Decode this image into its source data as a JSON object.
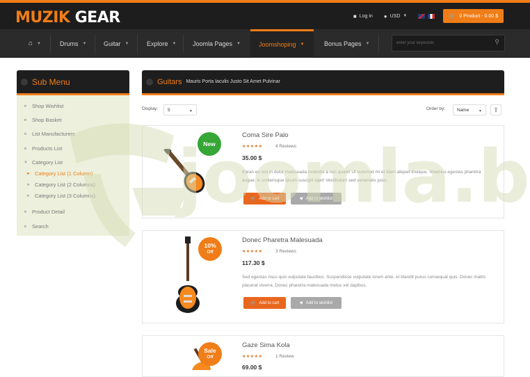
{
  "brand": {
    "part1": "MUZIK",
    "part2": "GEAR",
    "accent": "#f07d17"
  },
  "topbar": {
    "login": "Log in",
    "currency": "USD",
    "cart": "0 Product - 0.00 $"
  },
  "nav": {
    "items": [
      {
        "label": "Drums"
      },
      {
        "label": "Guitar"
      },
      {
        "label": "Explore"
      },
      {
        "label": "Joomla Pages"
      },
      {
        "label": "Joomshoping"
      },
      {
        "label": "Bonus Pages"
      }
    ],
    "search_placeholder": "enter your keywords"
  },
  "sidebar": {
    "title": "Sub Menu",
    "items": [
      {
        "label": "Shop Wishlist"
      },
      {
        "label": "Shop Basket"
      },
      {
        "label": "List Manufacturers"
      },
      {
        "label": "Products List"
      },
      {
        "label": "Category List"
      },
      {
        "label": "Category List (1 Column)"
      },
      {
        "label": "Category List (2 Columns)"
      },
      {
        "label": "Category List (3 Columns)"
      },
      {
        "label": "Product Detail"
      },
      {
        "label": "Search"
      }
    ]
  },
  "main": {
    "title": "Guitars",
    "subtitle": "Mauris Porta Iaculis Justo Sit Amet Pulvinar",
    "display_label": "Display:",
    "display_value": "5",
    "order_label": "Order by:",
    "order_value": "Name"
  },
  "products": [
    {
      "name": "Coma Sire Palo",
      "reviews": "4 Reviews",
      "price": "35.00 $",
      "desc": "Karan eu nisi in dolor malesuada molestie a nec quam! Ut euismod mi et diam aliquet tristique. Vivamus egestas pharetra augue, in scelerisque ipsum suscipit eget! Vestibulum sed venenatis justo.",
      "badge": "New",
      "cart": "Add to cart",
      "wish": "Add to wishlist"
    },
    {
      "name": "Donec Pharetra Malesuada",
      "reviews": "3 Reviews",
      "price": "117.30 $",
      "desc": "Sed egestas risus quis vulputate faucibus. Suspendisse vulputate lorem ante, et blandit purus consequat quis. Donec mattis placerat viverra. Donec pharetra malesuada metus vel dapibus.",
      "badge": "10%",
      "badge_sub": "Off",
      "cart": "Add to cart",
      "wish": "Add to wishlist"
    },
    {
      "name": "Gaze Sima Kola",
      "reviews": "1 Review",
      "price": "69.00 $",
      "badge": "Sale",
      "badge_sub": "Off"
    }
  ],
  "watermark": {
    "text": "joomla.bid"
  }
}
